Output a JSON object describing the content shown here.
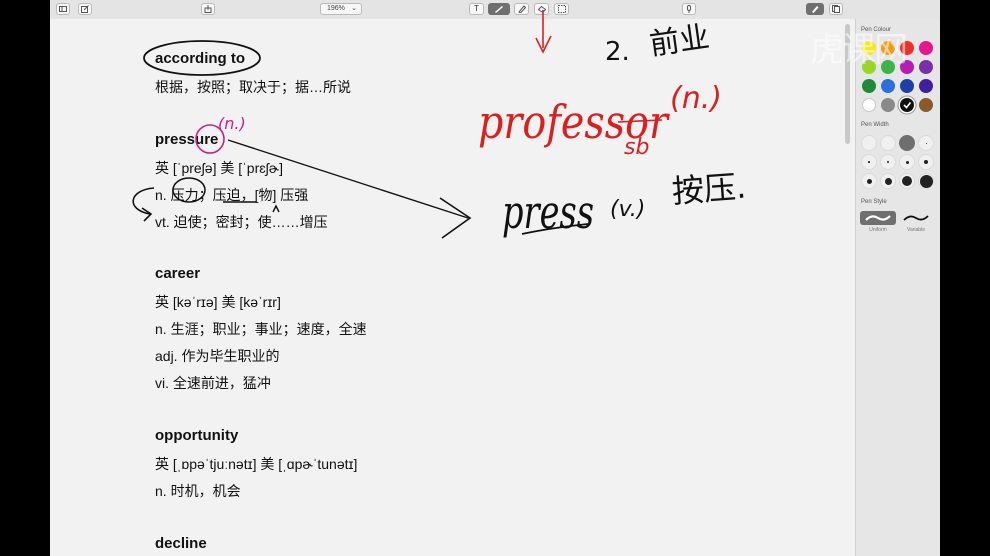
{
  "toolbar": {
    "zoom": "196%",
    "zoom_caret": "⌄",
    "text_tool": "T"
  },
  "entries": [
    {
      "word": "according to",
      "lines": [
        "根据，按照；取决于；据…所说"
      ]
    },
    {
      "word": "pressure",
      "lines": [
        "英 [ˈpreʃə]  美 [ˈprɛʃɚ]",
        "n. 压力；压迫，[物] 压强",
        "vt. 迫使；密封；使……增压"
      ]
    },
    {
      "word": "career",
      "lines": [
        "英 [kəˈrɪə]  美 [kəˈrɪr]",
        "n. 生涯；职业；事业；速度，全速",
        "adj. 作为毕生职业的",
        "vi. 全速前进，猛冲"
      ]
    },
    {
      "word": "opportunity",
      "lines": [
        "英 [ˌɒpəˈtjuːnətɪ]  美 [ˌɑpɚˈtunətɪ]",
        "n. 时机，机会"
      ]
    },
    {
      "word": "decline",
      "lines": []
    }
  ],
  "panel": {
    "pen_color_title": "Pen Colour",
    "pen_width_title": "Pen Width",
    "pen_style_title": "Pen Style",
    "style_uniform": "Uniform",
    "style_variable": "Variable",
    "colors": [
      "#f4e619",
      "#f09a1a",
      "#e8332a",
      "#e8168c",
      "#9ad62a",
      "#3db34a",
      "#b31fb3",
      "#7a2fa8",
      "#1f8a3a",
      "#2a6fe0",
      "#1f3fa8",
      "#3f1fa0",
      "#ffffff",
      "#8a8a8a",
      "#111111",
      "#8b5a2b"
    ]
  },
  "annotations": {
    "pressure_noun": "(n.)",
    "number_two": "2.",
    "chinese_note": "前业",
    "professor": "professor",
    "professor_paren": "(n.)",
    "professor_sub": "sb",
    "press": "press",
    "press_paren": "(v.)",
    "press_cn": "按压."
  },
  "watermark": "虎课网"
}
